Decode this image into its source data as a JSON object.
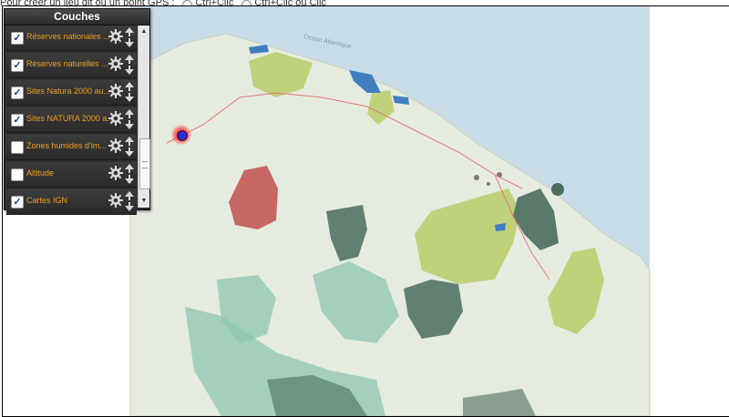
{
  "header": {
    "instruction": "Pour créer un lieu dit ou un point GPS :",
    "options": [
      "Ctrl+Clic",
      "Ctrl+Clic ou Clic"
    ]
  },
  "layers_panel": {
    "title": "Couches",
    "layers": [
      {
        "label": "Réserves nationales ...",
        "checked": true
      },
      {
        "label": "Réserves naturelles ...",
        "checked": true
      },
      {
        "label": "Sites Natura 2000 au...",
        "checked": true
      },
      {
        "label": "Sites NATURA 2000 a...",
        "checked": true
      },
      {
        "label": "Zones humides d'im...",
        "checked": false
      },
      {
        "label": "Altitude",
        "checked": false
      },
      {
        "label": "Cartes IGN",
        "checked": true
      }
    ]
  },
  "map": {
    "sea_label": "Océan Atlantique",
    "colors": {
      "sea": "#c9dde8",
      "land": "#e6ebe0",
      "reserve_national": "#4a6d5e",
      "reserve_natural": "#3f7fbf",
      "natura": "#b9cd6a",
      "zones": "#8ec6b0",
      "altitude_red": "#c0504d",
      "marker": "#2a2ad8"
    }
  }
}
